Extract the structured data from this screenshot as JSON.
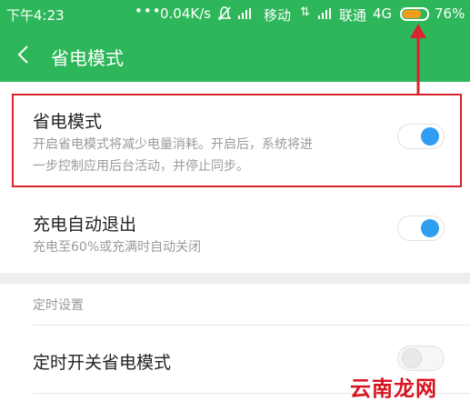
{
  "status_bar": {
    "time": "下午4:23",
    "dots": "•••",
    "net_speed": "0.04K/s",
    "carrier1": "移动",
    "carrier2": "联通",
    "net_type": "4G",
    "battery_percent": "76%",
    "battery_level": 0.76
  },
  "header": {
    "title": "省电模式"
  },
  "settings": [
    {
      "title": "省电模式",
      "description": [
        "开启省电模式将减少电量消耗。开启后，系统将进",
        "一步控制应用后台活动，并停止同步。"
      ],
      "enabled": true
    },
    {
      "title": "充电自动退出",
      "description": [
        "充电至60%或充满时自动关闭"
      ],
      "enabled": true
    }
  ],
  "schedule_section": {
    "label": "定时设置",
    "item_title": "定时开关省电模式",
    "enabled": false
  },
  "watermark": "云南龙网",
  "colors": {
    "header": "#2eb75a",
    "toggle_on": "#2f9ef0",
    "annotation": "#d7242e",
    "battery_fill": "#f39b1a"
  }
}
